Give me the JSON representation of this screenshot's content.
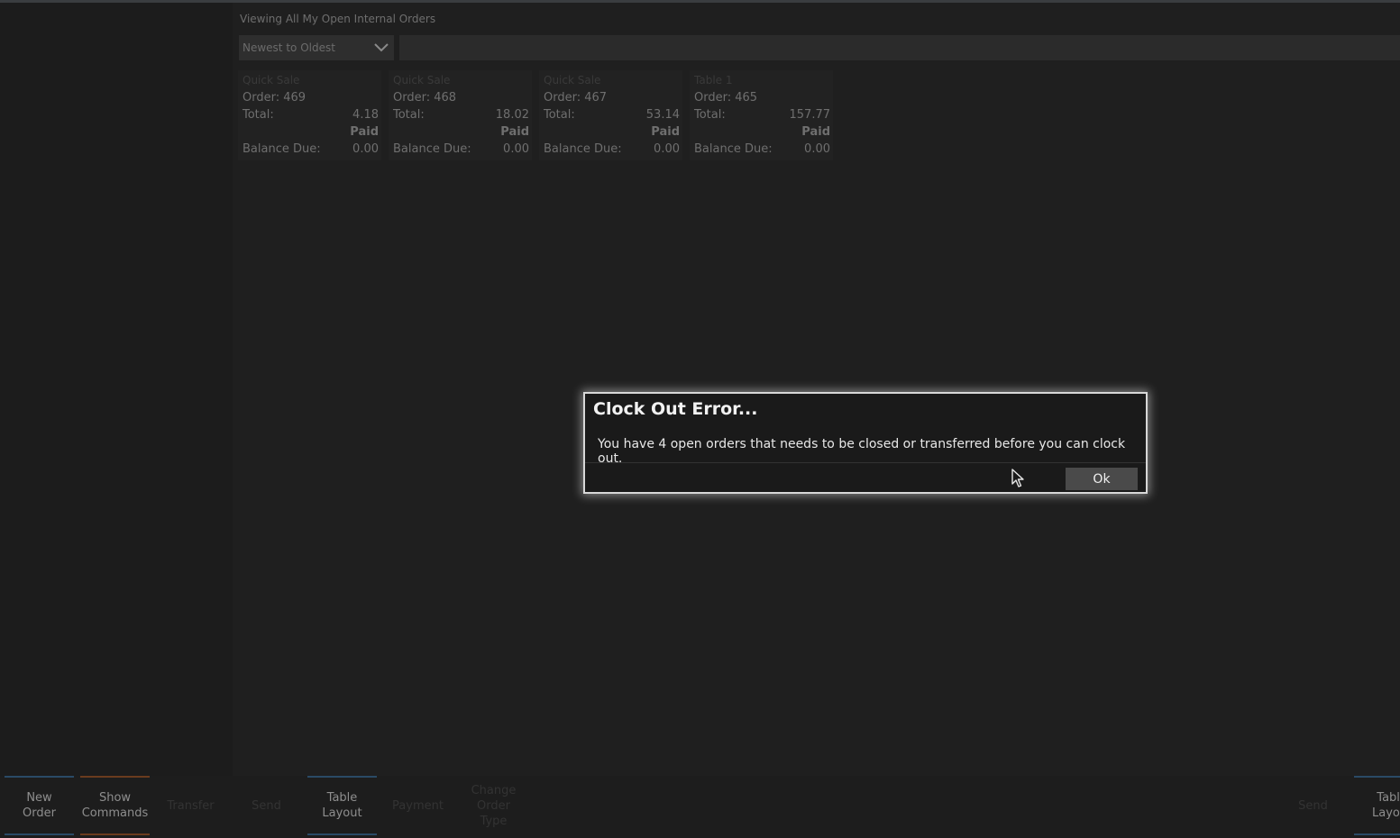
{
  "header": {
    "view_title": "Viewing All My Open Internal Orders",
    "sort_value": "Newest to Oldest"
  },
  "orders": [
    {
      "type": "Quick Sale",
      "order_label": "Order: 469",
      "total_label": "Total:",
      "total": "4.18",
      "status": "Paid",
      "balance_label": "Balance Due:",
      "balance": "0.00"
    },
    {
      "type": "Quick Sale",
      "order_label": "Order: 468",
      "total_label": "Total:",
      "total": "18.02",
      "status": "Paid",
      "balance_label": "Balance Due:",
      "balance": "0.00"
    },
    {
      "type": "Quick Sale",
      "order_label": "Order: 467",
      "total_label": "Total:",
      "total": "53.14",
      "status": "Paid",
      "balance_label": "Balance Due:",
      "balance": "0.00"
    },
    {
      "type": "Table 1",
      "order_label": "Order: 465",
      "total_label": "Total:",
      "total": "157.77",
      "status": "Paid",
      "balance_label": "Balance Due:",
      "balance": "0.00"
    }
  ],
  "dialog": {
    "title": "Clock Out Error...",
    "message": "You have 4 open orders that needs to be closed or transferred before you can clock out.",
    "ok_label": "Ok"
  },
  "commands": [
    {
      "label": "New\nOrder"
    },
    {
      "label": "Show\nCommands"
    },
    {
      "label": "Transfer"
    },
    {
      "label": "Send"
    },
    {
      "label": "Table\nLayout"
    },
    {
      "label": "Payment"
    },
    {
      "label": "Change\nOrder\nType"
    },
    {
      "label": "Send"
    },
    {
      "label": "Table\nLayout"
    }
  ],
  "colors": {
    "background": "#1f1f1f",
    "dialog_border": "#d8d8d8",
    "ok_button": "#4a4a4a",
    "accent_blue": "#2a4a66",
    "accent_orange": "#6a3b1e"
  }
}
